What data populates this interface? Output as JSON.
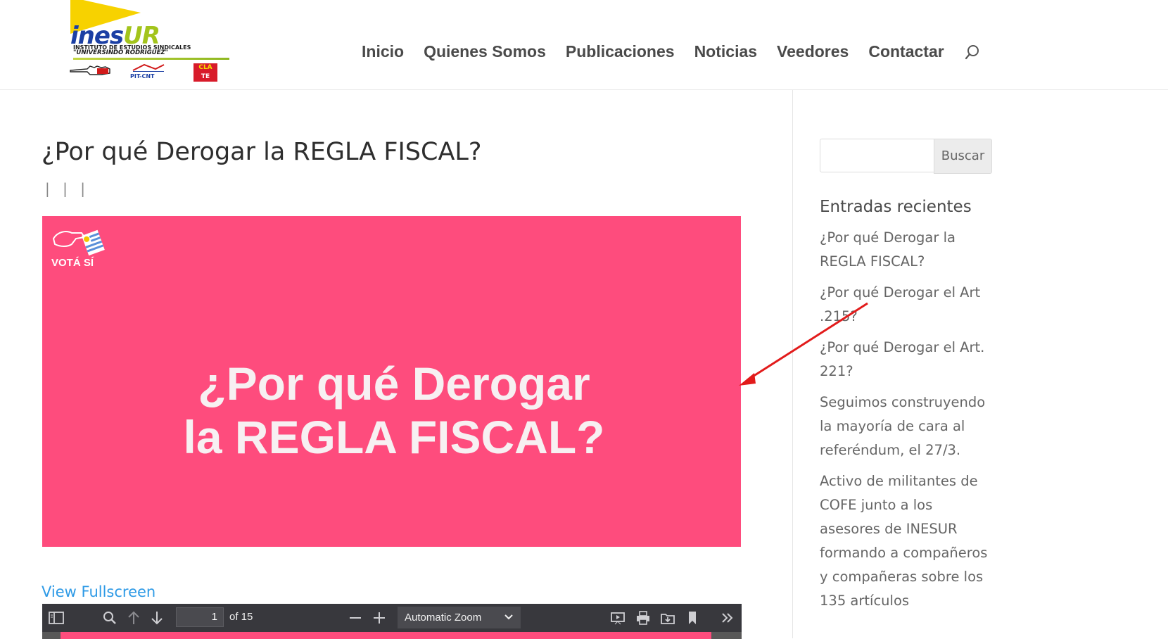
{
  "logo": {
    "word_main": "ines",
    "word_accent": "UR",
    "subtitle_line1": "INSTITUTO DE ESTUDIOS SINDICALES",
    "subtitle_line2": "\"UNIVERSINDO RODRIGUEZ\"",
    "org1": "",
    "org2": "PIT-CNT",
    "org3_top": "CLA",
    "org3_bottom": "TE"
  },
  "nav": {
    "items": [
      "Inicio",
      "Quienes Somos",
      "Publicaciones",
      "Noticias",
      "Veedores",
      "Contactar"
    ]
  },
  "post": {
    "title": "¿Por qué Derogar la REGLA FISCAL?",
    "meta": "| | |",
    "hero_badge": "VOTÁ SÍ",
    "hero_line1": "¿Por qué Derogar",
    "hero_line2": "la REGLA FISCAL?",
    "hero_color": "#fe4c7d",
    "fullscreen_link": "View Fullscreen"
  },
  "pdf_toolbar": {
    "page_value": "1",
    "page_count": "of 15",
    "zoom_label": "Automatic Zoom"
  },
  "sidebar": {
    "search_button": "Buscar",
    "recent_title": "Entradas recientes",
    "recent_posts": [
      "¿Por qué Derogar la REGLA FISCAL?",
      "¿Por qué Derogar el Art .215?",
      "¿Por qué Derogar el Art. 221?",
      "Seguimos construyendo la mayoría de cara al referéndum, el 27/3.",
      "Activo de militantes de COFE junto a los asesores de INESUR formando a compañeros y compañeras sobre los 135 artículos"
    ]
  }
}
